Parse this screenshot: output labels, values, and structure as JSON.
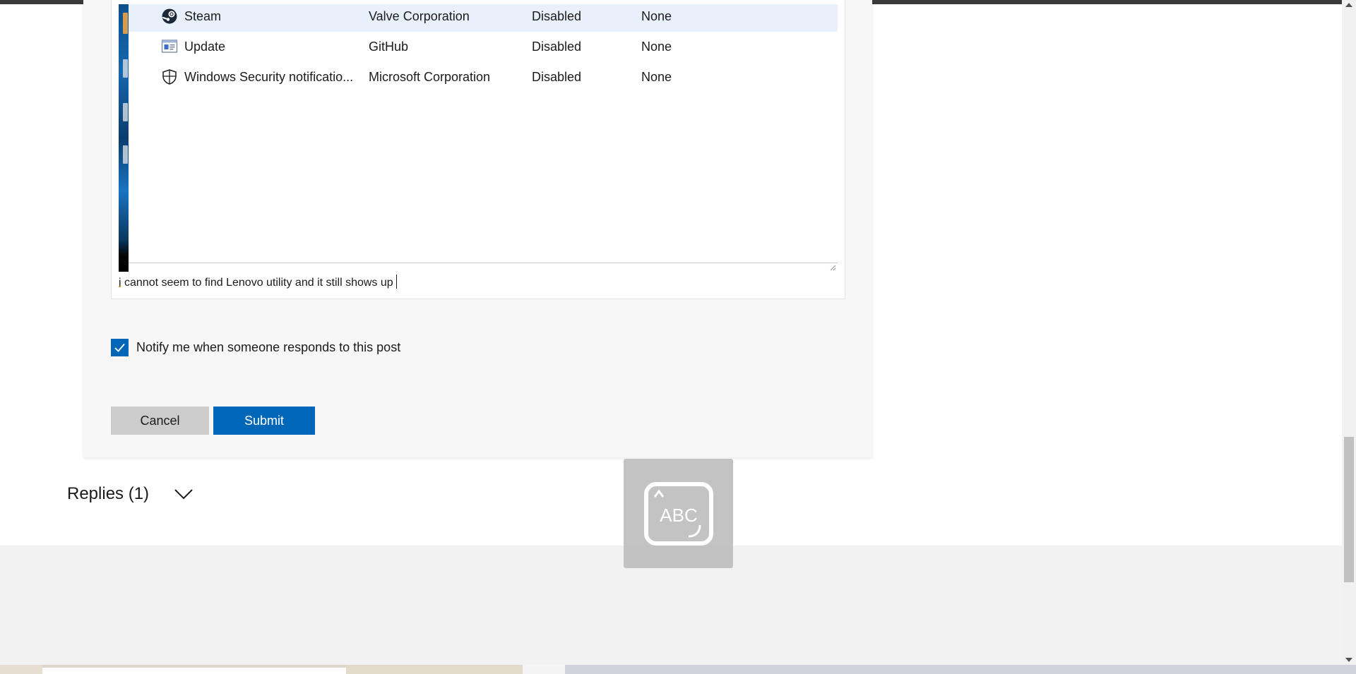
{
  "startup_apps": {
    "rows": [
      {
        "name": "Steam",
        "publisher": "Valve Corporation",
        "status": "Disabled",
        "impact": "None",
        "icon": "steam-icon",
        "selected": true
      },
      {
        "name": "Update",
        "publisher": "GitHub",
        "status": "Disabled",
        "impact": "None",
        "icon": "app-window-icon",
        "selected": false
      },
      {
        "name": "Windows Security notificatio...",
        "publisher": "Microsoft Corporation",
        "status": "Disabled",
        "impact": "None",
        "icon": "shield-icon",
        "selected": false
      }
    ]
  },
  "editor": {
    "first_char": "i",
    "rest_text": " cannot seem to find Lenovo utility and it still shows up"
  },
  "notify": {
    "label": "Notify me when someone responds to this post",
    "checked": true
  },
  "buttons": {
    "cancel": "Cancel",
    "submit": "Submit"
  },
  "replies": {
    "title": "Replies (1)"
  },
  "overlay": {
    "label": "ABC"
  },
  "colors": {
    "accent": "#0067b8",
    "selected_row": "#e8f1fb",
    "cancel_bg": "#cccccc",
    "footer_bg": "#f2f2f2"
  }
}
